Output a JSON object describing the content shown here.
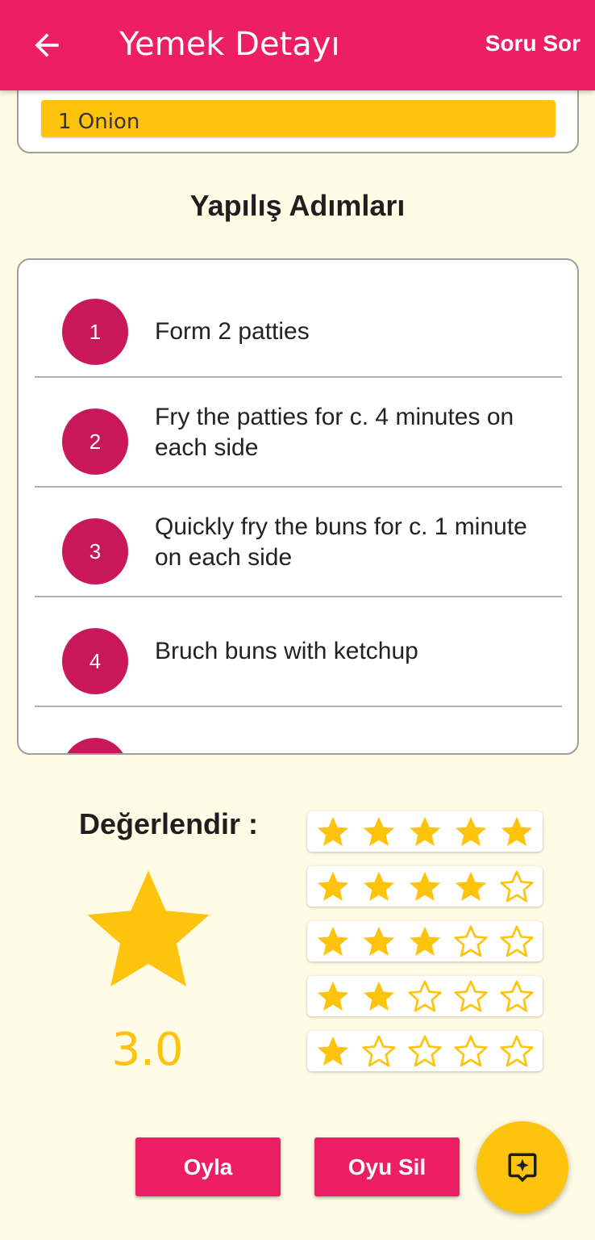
{
  "appbar": {
    "back_icon": "arrow-left-icon",
    "title": "Yemek Detayı",
    "ask_label": "Soru Sor"
  },
  "ingredients": {
    "visible_item": "1 Onion"
  },
  "steps": {
    "title": "Yapılış Adımları",
    "items": [
      {
        "number": "1",
        "text": "Form 2 patties"
      },
      {
        "number": "2",
        "text": "Fry the patties for c. 4 minutes on each side"
      },
      {
        "number": "3",
        "text": "Quickly fry the buns for c. 1 minute on each side"
      },
      {
        "number": "4",
        "text": "Bruch buns with ketchup"
      }
    ]
  },
  "rating": {
    "label": "Değerlendir :",
    "value": "3.0",
    "options": [
      5,
      4,
      3,
      2,
      1
    ],
    "star_color": "#fec30c"
  },
  "actions": {
    "vote_label": "Oyla",
    "delete_vote_label": "Oyu Sil",
    "fab_icon": "sparkle-review-icon"
  },
  "colors": {
    "primary": "#ec1f64",
    "step_circle": "#c8175b",
    "accent": "#fec30c",
    "background": "#fffbe4"
  }
}
